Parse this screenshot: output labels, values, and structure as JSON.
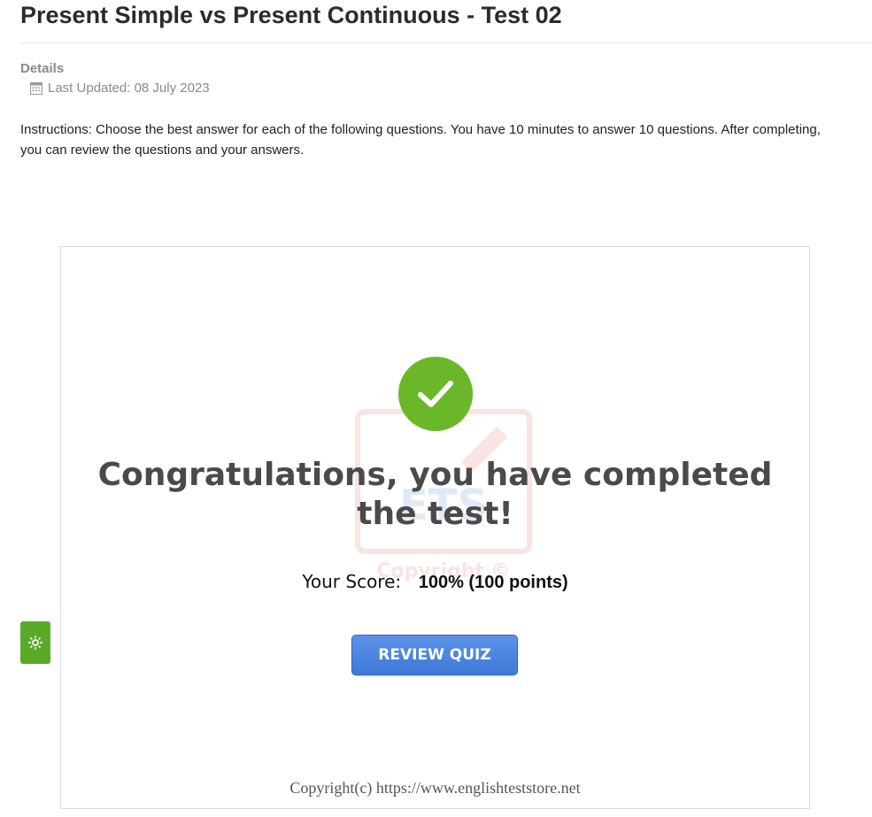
{
  "page": {
    "title": "Present Simple vs Present Continuous - Test 02",
    "details_label": "Details",
    "last_updated": "Last Updated: 08 July 2023",
    "instructions": "Instructions: Choose the best answer for each of the following questions. You have 10 minutes to answer 10 questions. After completing, you can review the questions and your answers."
  },
  "quiz": {
    "congrats_message": "Congratulations, you have completed the test!",
    "score_label": "Your Score:",
    "score_value": "100% (100 points)",
    "review_button_label": "REVIEW QUIZ",
    "copyright": "Copyright(c) https://www.englishteststore.net",
    "watermark": {
      "logo_text": "ETS",
      "text": "Copyright ©"
    }
  },
  "icons": {
    "calendar": "calendar-icon",
    "check": "check-circle-icon",
    "settings": "gear-icon"
  },
  "colors": {
    "success_green": "#6ab82a",
    "button_blue": "#4a82dd",
    "settings_green": "#5aaa28"
  }
}
